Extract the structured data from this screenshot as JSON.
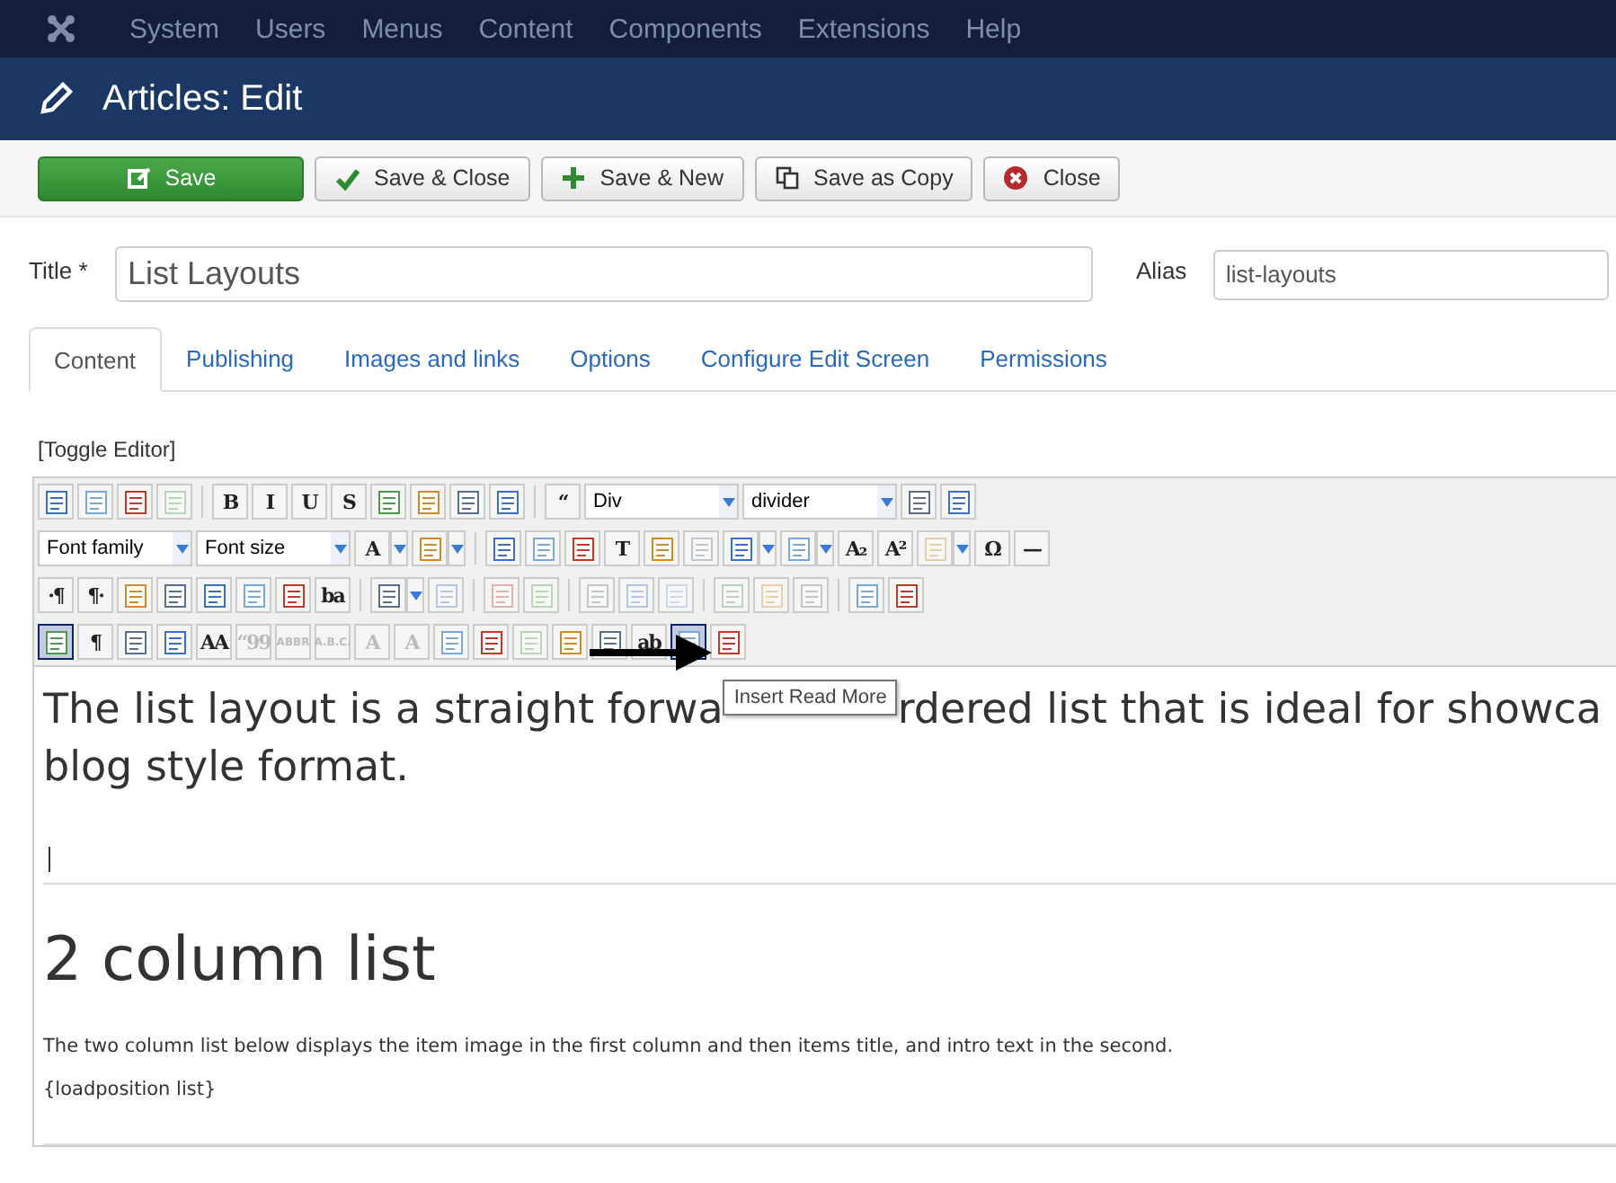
{
  "menu": [
    "System",
    "Users",
    "Menus",
    "Content",
    "Components",
    "Extensions",
    "Help"
  ],
  "header": {
    "title": "Articles: Edit"
  },
  "actions": [
    {
      "label": "Save",
      "kind": "primary"
    },
    {
      "label": "Save & Close",
      "kind": "default"
    },
    {
      "label": "Save & New",
      "kind": "default"
    },
    {
      "label": "Save as Copy",
      "kind": "default"
    },
    {
      "label": "Close",
      "kind": "default"
    }
  ],
  "title_field": {
    "label": "Title *",
    "value": "List Layouts"
  },
  "alias_field": {
    "label": "Alias",
    "value": "list-layouts"
  },
  "tabs": [
    {
      "label": "Content",
      "selected": true
    },
    {
      "label": "Publishing",
      "selected": false
    },
    {
      "label": "Images and links",
      "selected": false
    },
    {
      "label": "Options",
      "selected": false
    },
    {
      "label": "Configure Edit Screen",
      "selected": false
    },
    {
      "label": "Permissions",
      "selected": false
    }
  ],
  "toggle_editor": "[Toggle Editor]",
  "toolbar_rows": [
    [
      {
        "kind": "icon",
        "disabled": false,
        "selected": false
      },
      {
        "kind": "icon",
        "disabled": false,
        "selected": false
      },
      {
        "kind": "icon",
        "disabled": false,
        "selected": false
      },
      {
        "kind": "icon",
        "disabled": true,
        "selected": false
      },
      {
        "kind": "separator"
      },
      {
        "kind": "text",
        "label": "B",
        "disabled": false,
        "selected": false
      },
      {
        "kind": "text",
        "label": "I",
        "disabled": false,
        "selected": false
      },
      {
        "kind": "text",
        "label": "U",
        "disabled": false,
        "selected": false
      },
      {
        "kind": "text",
        "label": "S",
        "disabled": false,
        "selected": false
      },
      {
        "kind": "icon",
        "disabled": false,
        "selected": false
      },
      {
        "kind": "icon",
        "disabled": false,
        "selected": false
      },
      {
        "kind": "icon",
        "disabled": false,
        "selected": false
      },
      {
        "kind": "icon",
        "disabled": false,
        "selected": false
      },
      {
        "kind": "separator"
      },
      {
        "kind": "text",
        "label": "“",
        "disabled": false,
        "selected": false
      },
      {
        "kind": "select",
        "value": "Div"
      },
      {
        "kind": "select",
        "value": "divider"
      },
      {
        "kind": "icon",
        "disabled": false,
        "selected": false
      },
      {
        "kind": "icon",
        "disabled": false,
        "selected": false
      }
    ],
    [
      {
        "kind": "select",
        "value": "Font family"
      },
      {
        "kind": "select",
        "value": "Font size"
      },
      {
        "kind": "text",
        "label": "A",
        "disabled": false,
        "selected": false,
        "dropdown": true
      },
      {
        "kind": "icon",
        "disabled": false,
        "selected": false,
        "dropdown": true
      },
      {
        "kind": "separator"
      },
      {
        "kind": "icon",
        "disabled": false,
        "selected": false
      },
      {
        "kind": "icon",
        "disabled": false,
        "selected": false
      },
      {
        "kind": "icon",
        "disabled": false,
        "selected": false
      },
      {
        "kind": "text",
        "label": "T",
        "disabled": false,
        "selected": false
      },
      {
        "kind": "icon",
        "disabled": false,
        "selected": false
      },
      {
        "kind": "icon",
        "disabled": true,
        "selected": false
      },
      {
        "kind": "icon",
        "disabled": false,
        "selected": false,
        "dropdown": true
      },
      {
        "kind": "icon",
        "disabled": false,
        "selected": false,
        "dropdown": true
      },
      {
        "kind": "text",
        "label": "A₂",
        "disabled": false,
        "selected": false
      },
      {
        "kind": "text",
        "label": "A²",
        "disabled": false,
        "selected": false
      },
      {
        "kind": "icon",
        "disabled": true,
        "selected": false,
        "dropdown": true
      },
      {
        "kind": "text",
        "label": "Ω",
        "disabled": false,
        "selected": false
      },
      {
        "kind": "text",
        "label": "—",
        "disabled": false,
        "selected": false
      }
    ],
    [
      {
        "kind": "text",
        "label": "·¶",
        "disabled": false,
        "selected": false
      },
      {
        "kind": "text",
        "label": "¶·",
        "disabled": false,
        "selected": false
      },
      {
        "kind": "icon",
        "disabled": false,
        "selected": false
      },
      {
        "kind": "icon",
        "disabled": false,
        "selected": false
      },
      {
        "kind": "icon",
        "disabled": false,
        "selected": false
      },
      {
        "kind": "icon",
        "disabled": false,
        "selected": false
      },
      {
        "kind": "icon",
        "disabled": false,
        "selected": false
      },
      {
        "kind": "text",
        "label": "ba",
        "disabled": false,
        "selected": false
      },
      {
        "kind": "separator"
      },
      {
        "kind": "icon",
        "disabled": false,
        "selected": false,
        "dropdown": true
      },
      {
        "kind": "icon",
        "disabled": true,
        "selected": false
      },
      {
        "kind": "separator"
      },
      {
        "kind": "icon",
        "disabled": true,
        "selected": false
      },
      {
        "kind": "icon",
        "disabled": true,
        "selected": false
      },
      {
        "kind": "separator"
      },
      {
        "kind": "icon",
        "disabled": true,
        "selected": false
      },
      {
        "kind": "icon",
        "disabled": true,
        "selected": false
      },
      {
        "kind": "icon",
        "disabled": true,
        "selected": false
      },
      {
        "kind": "separator"
      },
      {
        "kind": "icon",
        "disabled": true,
        "selected": false
      },
      {
        "kind": "icon",
        "disabled": true,
        "selected": false
      },
      {
        "kind": "icon",
        "disabled": true,
        "selected": false
      },
      {
        "kind": "separator"
      },
      {
        "kind": "icon",
        "disabled": false,
        "selected": false
      },
      {
        "kind": "icon",
        "disabled": false,
        "selected": false
      }
    ],
    [
      {
        "kind": "icon",
        "disabled": false,
        "selected": true
      },
      {
        "kind": "text",
        "label": "¶",
        "disabled": false,
        "selected": false
      },
      {
        "kind": "icon",
        "disabled": false,
        "selected": false
      },
      {
        "kind": "icon",
        "disabled": false,
        "selected": false
      },
      {
        "kind": "text",
        "label": "AA",
        "disabled": false,
        "selected": false
      },
      {
        "kind": "text",
        "label": "“99",
        "disabled": true,
        "selected": false
      },
      {
        "kind": "text",
        "label": "ABBR",
        "disabled": true,
        "selected": false
      },
      {
        "kind": "text",
        "label": "A.B.C.",
        "disabled": true,
        "selected": false
      },
      {
        "kind": "text",
        "label": "A",
        "disabled": true,
        "selected": false
      },
      {
        "kind": "text",
        "label": "A",
        "disabled": true,
        "selected": false
      },
      {
        "kind": "icon",
        "disabled": false,
        "selected": false
      },
      {
        "kind": "icon",
        "disabled": false,
        "selected": false
      },
      {
        "kind": "icon",
        "disabled": true,
        "selected": false
      },
      {
        "kind": "icon",
        "disabled": false,
        "selected": false
      },
      {
        "kind": "icon",
        "disabled": false,
        "selected": false
      },
      {
        "kind": "text",
        "label": "ab",
        "disabled": false,
        "selected": false
      },
      {
        "kind": "icon",
        "disabled": false,
        "selected": true
      },
      {
        "kind": "icon",
        "disabled": false,
        "selected": false
      }
    ]
  ],
  "content": {
    "intro_start": "The list layout is a straight forwa",
    "tooltip": "Insert Read More",
    "intro_end": "rdered list that is ideal for showca",
    "intro_line2": "blog style format.",
    "heading": "2 column list",
    "paragraph": "The two column list below displays the item image in the first column and then items title, and intro text in the second.",
    "code": "{loadposition list}"
  }
}
